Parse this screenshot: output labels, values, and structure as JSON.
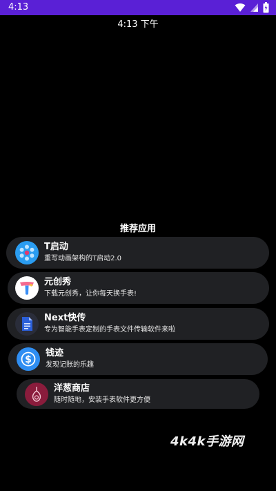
{
  "status_bar": {
    "time": "4:13"
  },
  "clock": {
    "text": "4:13 下午"
  },
  "section": {
    "title": "推荐应用"
  },
  "apps": [
    {
      "name": "T启动",
      "description": "重写动画架构的T启动2.0",
      "icon": "flower-dots-icon"
    },
    {
      "name": "元创秀",
      "description": "下载元创秀，让你每天换手表!",
      "icon": "t-logo-icon"
    },
    {
      "name": "Next快传",
      "description": "专为智能手表定制的手表文件传输软件来啦",
      "icon": "document-icon"
    },
    {
      "name": "钱迹",
      "description": "发现记账的乐趣",
      "icon": "dollar-icon"
    },
    {
      "name": "洋葱商店",
      "description": "随时随地，安装手表软件更方便",
      "icon": "onion-icon"
    }
  ],
  "watermark": {
    "text": "4k4k手游网"
  },
  "colors": {
    "status_bar": "#5a20d6",
    "card": "#202124",
    "t_launch": "#2a9cf0",
    "dollar": "#2f8ef2",
    "onion": "#8a1c3c",
    "document": "#2b5fd8"
  }
}
